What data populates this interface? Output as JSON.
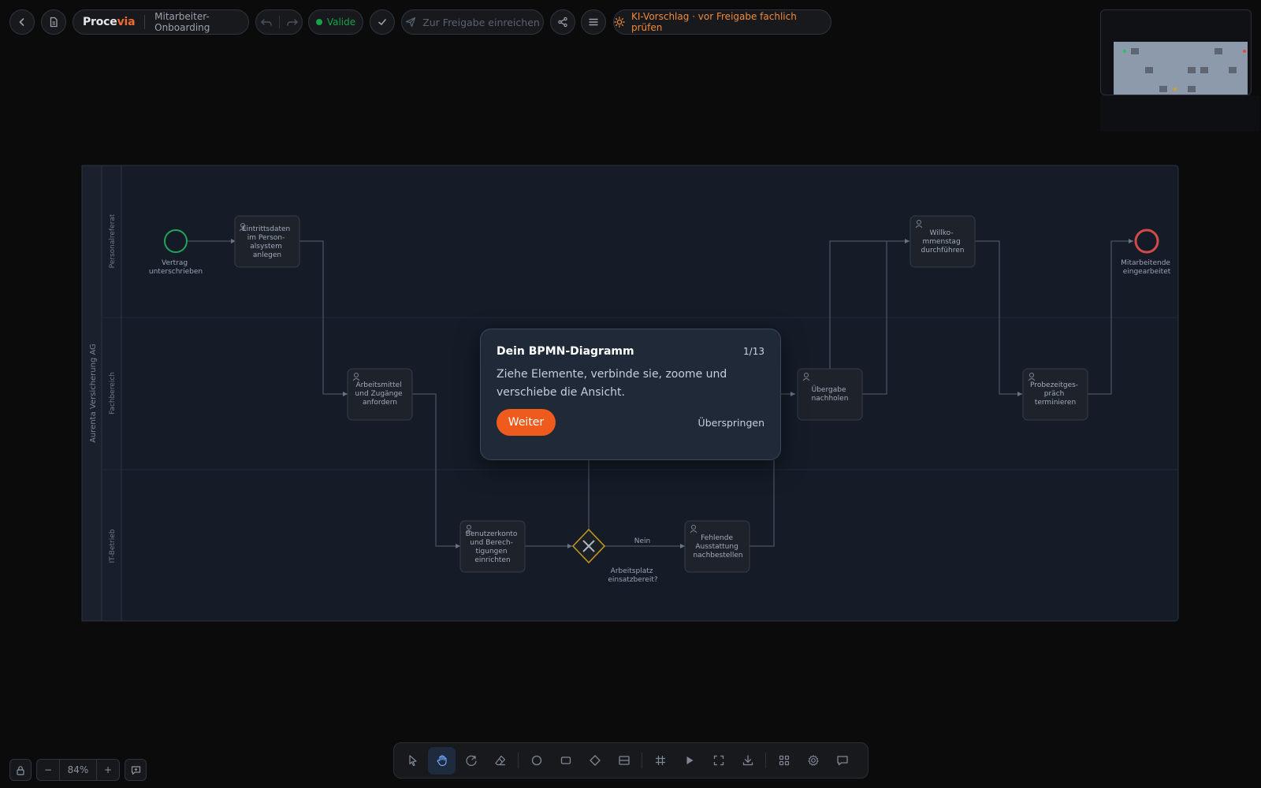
{
  "header": {
    "brand_main": "Proce",
    "brand_accent": "via",
    "process_name": "Mitarbeiter-Onboarding",
    "status_label": "Valide",
    "submit_label": "Zur Freigabe einreichen",
    "ki_label": "KI-Vorschlag · vor Freigabe fachlich prüfen"
  },
  "diagram": {
    "pool_label": "Aurenta Versicherung AG",
    "lanes": [
      "Personalreferat",
      "Fachbereich",
      "IT-Betrieb"
    ],
    "start_event": [
      "Vertrag",
      "unterschrieben"
    ],
    "end_event": [
      "Mitarbeitende",
      "eingearbeitet"
    ],
    "tasks": {
      "eintritt": [
        "Eintrittsdaten",
        "im Person-",
        "alsystem",
        "anlegen"
      ],
      "arbeitsmittel": [
        "Arbeitsmittel",
        "und Zugänge",
        "anfordern"
      ],
      "benutzerkonto": [
        "Benutzerkonto",
        "und Berech-",
        "tigungen",
        "einrichten"
      ],
      "fehlende": [
        "Fehlende",
        "Ausstattung",
        "nachbestellen"
      ],
      "uebergabe": [
        "Übergabe",
        "nachholen"
      ],
      "willkommen": [
        "Willko-",
        "mmenstag",
        "durchführen"
      ],
      "probezeit": [
        "Probezeitges-",
        "präch",
        "terminieren"
      ]
    },
    "gateway_label": [
      "Arbeitsplatz",
      "einsatzbereit?"
    ],
    "flow_label_nein": "Nein"
  },
  "onboarding_modal": {
    "title": "Dein BPMN-Diagramm",
    "step": "1/13",
    "body": "Ziehe Elemente, verbinde sie, zoome und verschiebe die Ansicht.",
    "next_label": "Weiter",
    "skip_label": "Überspringen"
  },
  "zoom": {
    "level": "84%",
    "minus": "−",
    "plus": "+"
  },
  "colors": {
    "accent": "#ee5b1c",
    "valid": "#16a34a",
    "start_event": "#22c55e",
    "end_event": "#ef4444",
    "gateway": "#d4a017"
  }
}
